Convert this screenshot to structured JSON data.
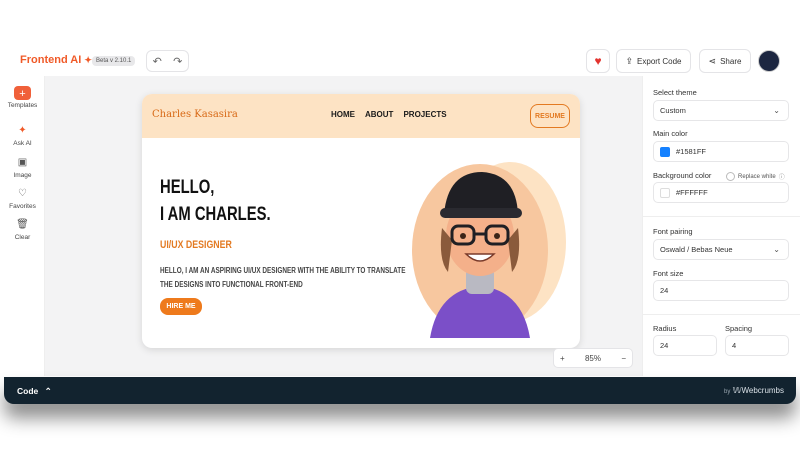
{
  "app": {
    "name": "Frontend AI",
    "beta_label": "Beta v 2.10.1"
  },
  "toolbar": {
    "export_label": "Export Code",
    "share_label": "Share"
  },
  "sidebar": {
    "items": [
      {
        "label": "Templates",
        "icon": "plus-icon"
      },
      {
        "label": "Ask AI",
        "icon": "sparkle-icon"
      },
      {
        "label": "Image",
        "icon": "image-icon"
      },
      {
        "label": "Favorites",
        "icon": "heart-icon"
      },
      {
        "label": "Clear",
        "icon": "trash-icon"
      }
    ]
  },
  "preview": {
    "logo": "Charles Kasasira",
    "nav": [
      "HOME",
      "ABOUT",
      "PROJECTS"
    ],
    "resume_label": "RESUME",
    "hello_line1": "HELLO,",
    "hello_line2": "I AM CHARLES.",
    "role": "UI/UX DESIGNER",
    "description": "HELLO, I AM AN ASPIRING UI/UX DESIGNER WITH THE ABILITY TO TRANSLATE THE DESIGNS INTO FUNCTIONAL FRONT-END",
    "hire_label": "HIRE ME",
    "colors": {
      "header_bg": "#fde3c4",
      "accent": "#ee7a1c"
    }
  },
  "zoom": {
    "level": "85%"
  },
  "panel": {
    "theme_label": "Select theme",
    "theme_value": "Custom",
    "main_color_label": "Main color",
    "main_color_value": "#1581FF",
    "bg_color_label": "Background color",
    "replace_white_label": "Replace white",
    "bg_color_value": "#FFFFFF",
    "font_pairing_label": "Font pairing",
    "font_pairing_value": "Oswald / Bebas Neue",
    "font_size_label": "Font size",
    "font_size_value": "24",
    "radius_label": "Radius",
    "radius_value": "24",
    "spacing_label": "Spacing",
    "spacing_value": "4"
  },
  "codebar": {
    "label": "Code",
    "by_prefix": "by",
    "by_brand": "Webcrumbs"
  }
}
